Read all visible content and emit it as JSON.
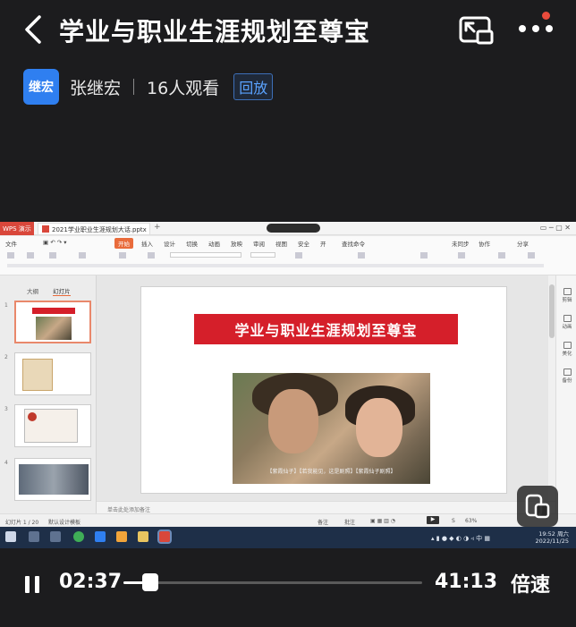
{
  "header": {
    "title": "学业与职业生涯规划至尊宝",
    "host": {
      "avatar_text": "继宏",
      "name": "张继宏",
      "viewers": "16人观看",
      "replay_label": "回放"
    }
  },
  "screen_share": {
    "wps_tag": "WPS 演示",
    "doc_tab": "2021学业职业生涯规划大话.pptx",
    "menu": {
      "file": "文件",
      "items": [
        "开始",
        "插入",
        "设计",
        "切换",
        "动画",
        "放映",
        "审阅",
        "视图",
        "安全",
        "开"
      ],
      "active": "开始",
      "search": "查找命令",
      "right": [
        "未同步",
        "协作",
        "分享"
      ]
    },
    "panel_tabs": [
      "大纲",
      "幻灯片"
    ],
    "thumb_numbers": [
      "1",
      "2",
      "3",
      "4"
    ],
    "slide": {
      "banner": "学业与职业生涯规划至尊宝",
      "caption": "【紫霞仙子】【若我能见，这是剧照】【紫霞仙子剧照】"
    },
    "right_panel": [
      "剪辑",
      "动画",
      "美化",
      "备份"
    ],
    "notes_placeholder": "单击此处添加备注",
    "status": {
      "slide_count": "幻灯片 1 / 20",
      "theme": "默认设计模板",
      "notes_btn": "备注",
      "comments_btn": "批注",
      "zoom": "63%"
    },
    "taskbar": {
      "time": "19:52 周六",
      "date": "2022/11/25",
      "lang": "中"
    }
  },
  "player": {
    "current_time": "02:37",
    "total_time": "41:13",
    "speed_label": "倍速",
    "progress": 0.09
  },
  "colors": {
    "accent_blue": "#2f7ff0",
    "slide_red": "#d51f2a",
    "wps_orange": "#e96b3b"
  }
}
